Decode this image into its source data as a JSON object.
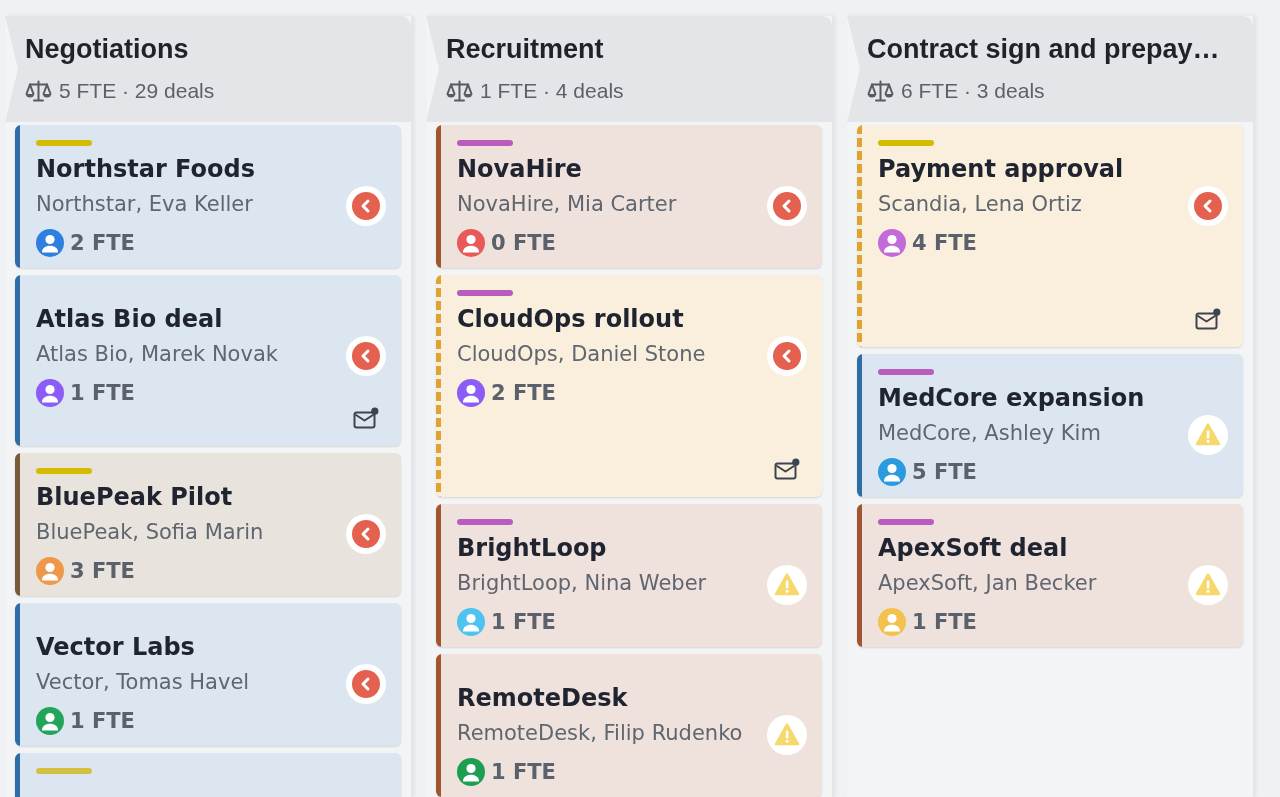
{
  "columns": [
    {
      "title": "Negotiations",
      "summary": "5 FTE · 29 deals",
      "cards": [
        {
          "tag": {
            "color": "#d4bc00"
          },
          "title": "Northstar Foods",
          "subtitle": "Northstar, Eva Keller",
          "fte": "2 FTE",
          "avatar": {
            "color": "#2f7fe0"
          },
          "accent": {
            "color": "#2e6da6",
            "kind": "solid"
          },
          "indicator": {
            "kind": "back"
          },
          "mail": false
        },
        {
          "title": "Atlas Bio deal",
          "subtitle": "Atlas Bio, Marek Novak",
          "fte": "1 FTE",
          "avatar": {
            "color": "#8b5cf6"
          },
          "accent": {
            "color": "#2e6da6",
            "kind": "solid"
          },
          "indicator": {
            "kind": "back"
          },
          "mail": true
        },
        {
          "tag": {
            "color": "#d4bc00"
          },
          "title": "BluePeak Pilot",
          "subtitle": "BluePeak, Sofia Marin",
          "fte": "3 FTE",
          "avatar": {
            "color": "#f0984a"
          },
          "accent": {
            "color": "#7b5a3a",
            "kind": "solid"
          },
          "indicator": {
            "kind": "back"
          },
          "mail": false
        },
        {
          "title": "Vector Labs",
          "subtitle": "Vector, Tomas Havel",
          "fte": "1 FTE",
          "avatar": {
            "color": "#22a55a"
          },
          "accent": {
            "color": "#2e6da6",
            "kind": "solid"
          },
          "indicator": {
            "kind": "back"
          },
          "mail": false
        },
        {
          "tag": {
            "color": "#d4c040"
          },
          "accent": {
            "color": "#2e6da6",
            "kind": "solid"
          }
        }
      ]
    },
    {
      "title": "Recruitment",
      "summary": "1 FTE · 4 deals",
      "cards": [
        {
          "tag": {
            "color": "#b85cc0"
          },
          "title": "NovaHire",
          "subtitle": "NovaHire, Mia Carter",
          "fte": "0 FTE",
          "avatar": {
            "color": "#e85a5a"
          },
          "accent": {
            "color": "#a0552f",
            "kind": "solid"
          },
          "indicator": {
            "kind": "back"
          },
          "mail": false
        },
        {
          "tag": {
            "color": "#b85cc0"
          },
          "title": "CloudOps rollout",
          "subtitle": "CloudOps, Daniel Stone",
          "fte": "2 FTE",
          "avatar": {
            "color": "#8b5cf6"
          },
          "accent": {
            "color": "#e0a331",
            "kind": "dashed"
          },
          "indicator": {
            "kind": "back"
          },
          "mail": true
        },
        {
          "tag": {
            "color": "#b85cc0"
          },
          "title": "BrightLoop",
          "subtitle": "BrightLoop, Nina Weber",
          "fte": "1 FTE",
          "avatar": {
            "color": "#4fc3f0"
          },
          "accent": {
            "color": "#a0552f",
            "kind": "solid"
          },
          "indicator": {
            "kind": "warning"
          },
          "mail": false
        },
        {
          "title": "RemoteDesk",
          "subtitle": "RemoteDesk, Filip Rudenko",
          "fte": "1 FTE",
          "avatar": {
            "color": "#1e9e50"
          },
          "accent": {
            "color": "#a0552f",
            "kind": "solid"
          },
          "indicator": {
            "kind": "warning"
          },
          "mail": false
        }
      ]
    },
    {
      "title": "Contract sign and prepay…",
      "summary": "6 FTE · 3 deals",
      "cards": [
        {
          "tag": {
            "color": "#d4bc00"
          },
          "title": "Payment approval",
          "subtitle": "Scandia, Lena Ortiz",
          "fte": "4 FTE",
          "avatar": {
            "color": "#c26ad9"
          },
          "accent": {
            "color": "#e0a331",
            "kind": "dashed"
          },
          "indicator": {
            "kind": "back"
          },
          "mail": true
        },
        {
          "tag": {
            "color": "#b85cc0"
          },
          "title": "MedCore expansion",
          "subtitle": "MedCore, Ashley Kim",
          "fte": "5 FTE",
          "avatar": {
            "color": "#2b9be0"
          },
          "accent": {
            "color": "#2e6da6",
            "kind": "solid"
          },
          "indicator": {
            "kind": "warning"
          },
          "mail": false
        },
        {
          "tag": {
            "color": "#b85cc0"
          },
          "title": "ApexSoft deal",
          "subtitle": "ApexSoft, Jan Becker",
          "fte": "1 FTE",
          "avatar": {
            "color": "#f2c14e"
          },
          "accent": {
            "color": "#a0552f",
            "kind": "solid"
          },
          "indicator": {
            "kind": "warning"
          },
          "mail": false
        }
      ]
    }
  ]
}
